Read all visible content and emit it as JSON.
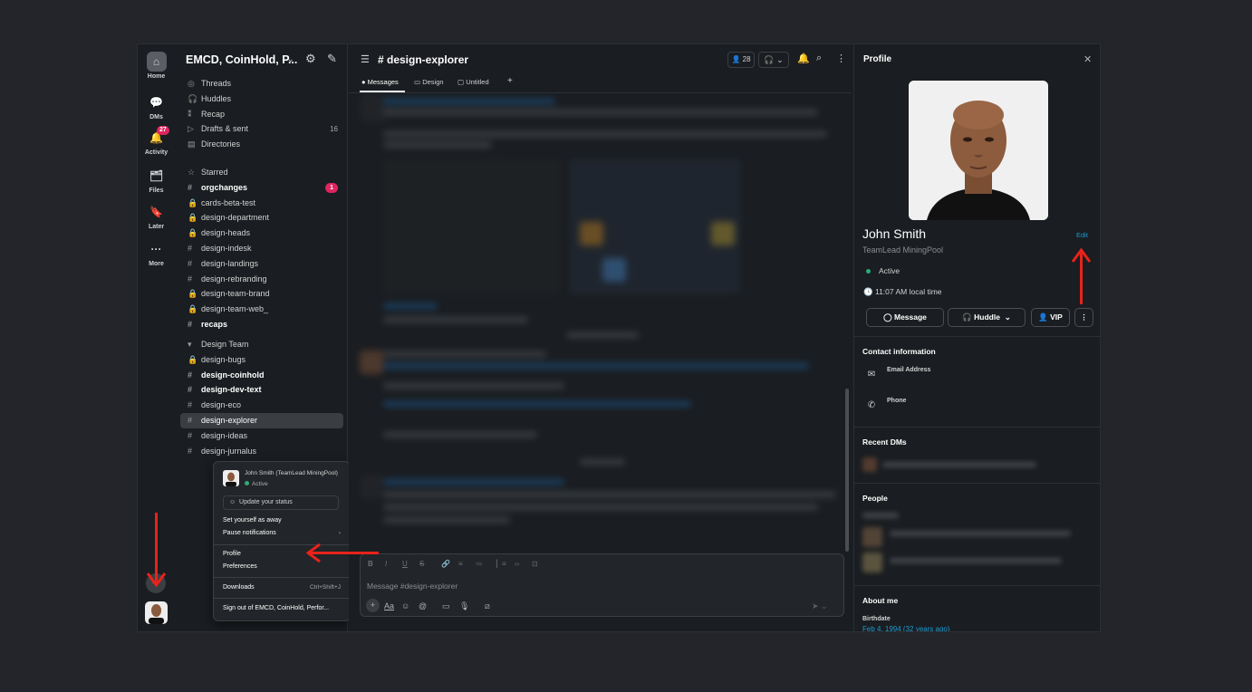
{
  "rail": {
    "home": "Home",
    "dms": "DMs",
    "activity": "Activity",
    "activity_badge": "27",
    "files": "Files",
    "later": "Later",
    "more": "More"
  },
  "workspace": {
    "name": "EMCD, CoinHold, P..."
  },
  "sidebar": {
    "nav": [
      {
        "icon": "threads-icon",
        "label": "Threads"
      },
      {
        "icon": "headphones-icon",
        "label": "Huddles"
      },
      {
        "icon": "recap-icon",
        "label": "Recap"
      },
      {
        "icon": "send-icon",
        "label": "Drafts & sent",
        "count": "16"
      },
      {
        "icon": "directory-icon",
        "label": "Directories"
      }
    ],
    "starred_label": "Starred",
    "starred": [
      {
        "icon": "#",
        "label": "orgchanges",
        "bold": true,
        "badge": "1"
      },
      {
        "icon": "lock",
        "label": "cards-beta-test"
      },
      {
        "icon": "lock",
        "label": "design-department"
      },
      {
        "icon": "lock",
        "label": "design-heads"
      },
      {
        "icon": "#",
        "label": "design-indesk"
      },
      {
        "icon": "#",
        "label": "design-landings"
      },
      {
        "icon": "#",
        "label": "design-rebranding"
      },
      {
        "icon": "lock",
        "label": "design-team-brand"
      },
      {
        "icon": "lock",
        "label": "design-team-web_"
      },
      {
        "icon": "#",
        "label": "recaps",
        "bold": true
      }
    ],
    "team_label": "Design Team",
    "team": [
      {
        "icon": "lock",
        "label": "design-bugs"
      },
      {
        "icon": "#",
        "label": "design-coinhold",
        "bold": true
      },
      {
        "icon": "#",
        "label": "design-dev-text",
        "bold": true
      },
      {
        "icon": "#",
        "label": "design-eco"
      },
      {
        "icon": "#",
        "label": "design-explorer",
        "selected": true
      },
      {
        "icon": "#",
        "label": "design-ideas"
      },
      {
        "icon": "#",
        "label": "design-jurnalus"
      }
    ]
  },
  "menu": {
    "user": "John Smith (TeamLead MiningPool)",
    "status": "Active",
    "update_status": "Update your status",
    "away": "Set yourself as away",
    "pause": "Pause notifications",
    "profile": "Profile",
    "preferences": "Preferences",
    "downloads": "Downloads",
    "downloads_shortcut": "Ctrl+Shift+J",
    "signout": "Sign out of EMCD, CoinHold, Perfor..."
  },
  "channel": {
    "title": "# design-explorer",
    "members": "28",
    "tabs": [
      "Messages",
      "Design",
      "Untitled"
    ],
    "composer_placeholder": "Message #design-explorer"
  },
  "profile": {
    "title": "Profile",
    "name": "John Smith",
    "edit": "Edit",
    "role": "TeamLead MiningPool",
    "status": "Active",
    "local_time": "11:07 AM local time",
    "btn_message": "Message",
    "btn_huddle": "Huddle",
    "btn_vip": "VIP",
    "contact_title": "Contact information",
    "email_label": "Email Address",
    "phone_label": "Phone",
    "recent_dms": "Recent DMs",
    "people": "People",
    "about": "About me",
    "birthdate_label": "Birthdate",
    "birthdate_value": "Feb 4, 1994 (32 years ago)"
  },
  "colors": {
    "accent": "#1d9bd1",
    "arrow": "#e8231a",
    "active": "#2bac76",
    "badge": "#e0245e"
  }
}
